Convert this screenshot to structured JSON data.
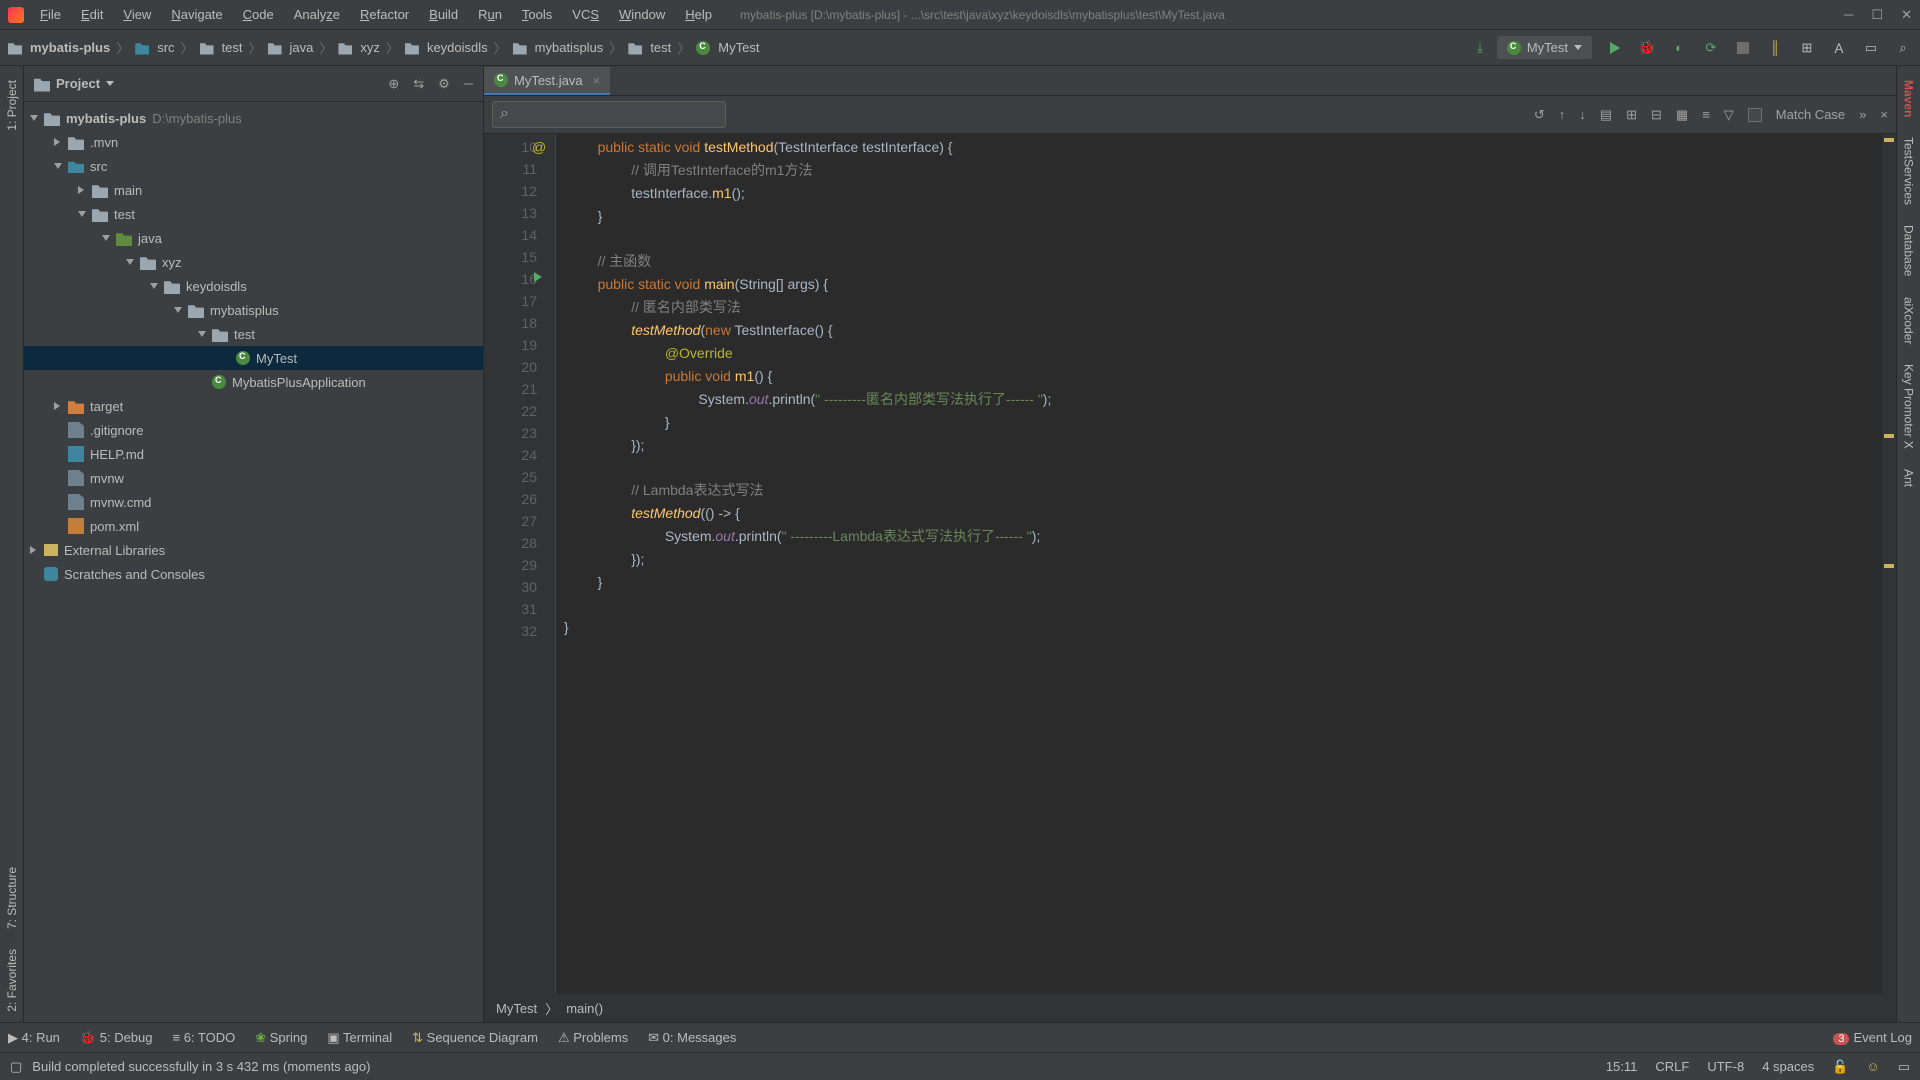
{
  "titlebar": {
    "menu": [
      "File",
      "Edit",
      "View",
      "Navigate",
      "Code",
      "Analyze",
      "Refactor",
      "Build",
      "Run",
      "Tools",
      "VCS",
      "Window",
      "Help"
    ],
    "path": "mybatis-plus [D:\\mybatis-plus] - ...\\src\\test\\java\\xyz\\keydoisdls\\mybatisplus\\test\\MyTest.java"
  },
  "breadcrumbs": [
    "mybatis-plus",
    "src",
    "test",
    "java",
    "xyz",
    "keydoisdls",
    "mybatisplus",
    "test",
    "MyTest"
  ],
  "run_config": "MyTest",
  "project_panel": {
    "title": "Project"
  },
  "tree": {
    "root": {
      "name": "mybatis-plus",
      "hint": "D:\\mybatis-plus"
    },
    "mvn": ".mvn",
    "src": "src",
    "main": "main",
    "test": "test",
    "java": "java",
    "xyz": "xyz",
    "keydoisdls": "keydoisdls",
    "mybatisplus": "mybatisplus",
    "test2": "test",
    "mytest": "MyTest",
    "app": "MybatisPlusApplication",
    "target": "target",
    "gitignore": ".gitignore",
    "help": "HELP.md",
    "mvnw": "mvnw",
    "mvnwcmd": "mvnw.cmd",
    "pom": "pom.xml",
    "extlib": "External Libraries",
    "scratch": "Scratches and Consoles"
  },
  "tab": {
    "name": "MyTest.java"
  },
  "findbar": {
    "match_case": "Match Case"
  },
  "gutter": {
    "lines": [
      "10",
      "11",
      "12",
      "13",
      "14",
      "15",
      "16",
      "17",
      "18",
      "19",
      "20",
      "21",
      "22",
      "23",
      "24",
      "25",
      "26",
      "27",
      "28",
      "29",
      "30",
      "31",
      "32"
    ]
  },
  "code": {
    "l10_at": "@",
    "l10a": "public static void ",
    "l10b": "testMethod",
    "l10c": "(",
    "l10d": "TestInterface",
    "l10e": " testInterface) {",
    "l11": "// 调用TestInterface的m1方法",
    "l12a": "testInterface.",
    "l12b": "m1",
    "l12c": "();",
    "l13": "}",
    "l15": "// 主函数",
    "l16a": "public static void ",
    "l16b": "main",
    "l16c": "(",
    "l16d": "String",
    "l16e": "[] args) {",
    "l17": "// 匿名内部类写法",
    "l18a": "testMethod",
    "l18b": "(",
    "l18c": "new ",
    "l18d": "TestInterface",
    "l18e": "() {",
    "l19": "@Override",
    "l20a": "public void ",
    "l20b": "m1",
    "l20c": "() {",
    "l21a": "System.",
    "l21b": "out",
    "l21c": ".println(",
    "l21d": "\" ---------匿名内部类写法执行了------ \"",
    "l21e": ");",
    "l22": "}",
    "l23": "});",
    "l25": "// Lambda表达式写法",
    "l26a": "testMethod",
    "l26b": "(() -> {",
    "l27a": "System.",
    "l27b": "out",
    "l27c": ".println(",
    "l27d": "\" ---------Lambda表达式写法执行了------ \"",
    "l27e": ");",
    "l28": "});",
    "l29": "}",
    "l31": "}"
  },
  "editor_crumb": {
    "a": "MyTest",
    "b": "main()"
  },
  "left_rail": {
    "project": "1: Project",
    "structure": "7: Structure",
    "favorites": "2: Favorites"
  },
  "right_rail": {
    "maven": "Maven",
    "testservices": "TestServices",
    "database": "Database",
    "aix": "aiXcoder",
    "keypromoter": "Key Promoter X",
    "ant": "Ant"
  },
  "statusbar": {
    "run": "4: Run",
    "debug": "5: Debug",
    "todo": "6: TODO",
    "spring": "Spring",
    "terminal": "Terminal",
    "seq": "Sequence Diagram",
    "problems": "Problems",
    "messages": "0: Messages",
    "eventlog": "Event Log",
    "eventcount": "3",
    "time": "15:11",
    "eol": "CRLF",
    "enc": "UTF-8",
    "indent": "4 spaces"
  },
  "msgbar": {
    "text": "Build completed successfully in 3 s 432 ms (moments ago)"
  }
}
